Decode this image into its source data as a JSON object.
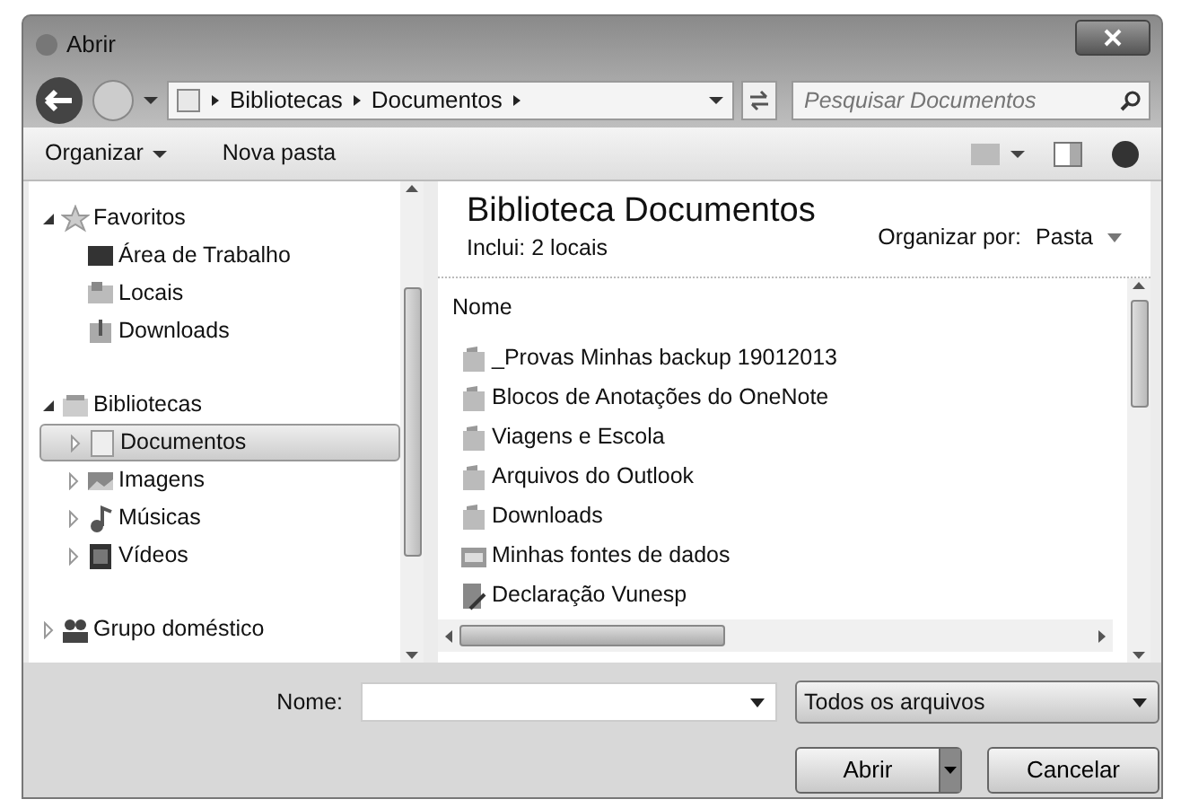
{
  "window": {
    "title": "Abrir"
  },
  "address": {
    "crumbs": [
      "Bibliotecas",
      "Documentos"
    ]
  },
  "search": {
    "placeholder": "Pesquisar Documentos"
  },
  "toolbar": {
    "organize": "Organizar",
    "new_folder": "Nova pasta"
  },
  "navigation": [
    {
      "label": "Favoritos",
      "kind": "star",
      "expanded": true,
      "children": [
        {
          "label": "Área de Trabalho",
          "kind": "desktop",
          "selected": false
        },
        {
          "label": "Locais",
          "kind": "places",
          "selected": false
        },
        {
          "label": "Downloads",
          "kind": "download",
          "selected": false
        }
      ]
    },
    {
      "label": "Bibliotecas",
      "kind": "library",
      "expanded": true,
      "children": [
        {
          "label": "Documentos",
          "kind": "document",
          "expanded": false,
          "selected": true
        },
        {
          "label": "Imagens",
          "kind": "image",
          "expanded": false,
          "selected": false
        },
        {
          "label": "Músicas",
          "kind": "music",
          "expanded": false,
          "selected": false
        },
        {
          "label": "Vídeos",
          "kind": "video",
          "expanded": false,
          "selected": false
        }
      ]
    },
    {
      "label": "Grupo doméstico",
      "kind": "group",
      "expanded": false
    }
  ],
  "library": {
    "title": "Biblioteca Documentos",
    "subtitle": "Inclui: 2 locais",
    "arrange_label": "Organizar por:",
    "arrange_value": "Pasta"
  },
  "files": {
    "column": "Nome",
    "items": [
      {
        "name": "_Provas Minhas backup 19012013",
        "kind": "folder"
      },
      {
        "name": "Blocos de Anotações do OneNote",
        "kind": "folder"
      },
      {
        "name": "Viagens e Escola",
        "kind": "folder"
      },
      {
        "name": "Arquivos do Outlook",
        "kind": "folder"
      },
      {
        "name": "Downloads",
        "kind": "folder"
      },
      {
        "name": "Minhas fontes de dados",
        "kind": "database"
      },
      {
        "name": "Declaração Vunesp",
        "kind": "document"
      }
    ]
  },
  "filename": {
    "label": "Nome:"
  },
  "filetype": {
    "value": "Todos os arquivos"
  },
  "buttons": {
    "open": "Abrir",
    "cancel": "Cancelar"
  }
}
